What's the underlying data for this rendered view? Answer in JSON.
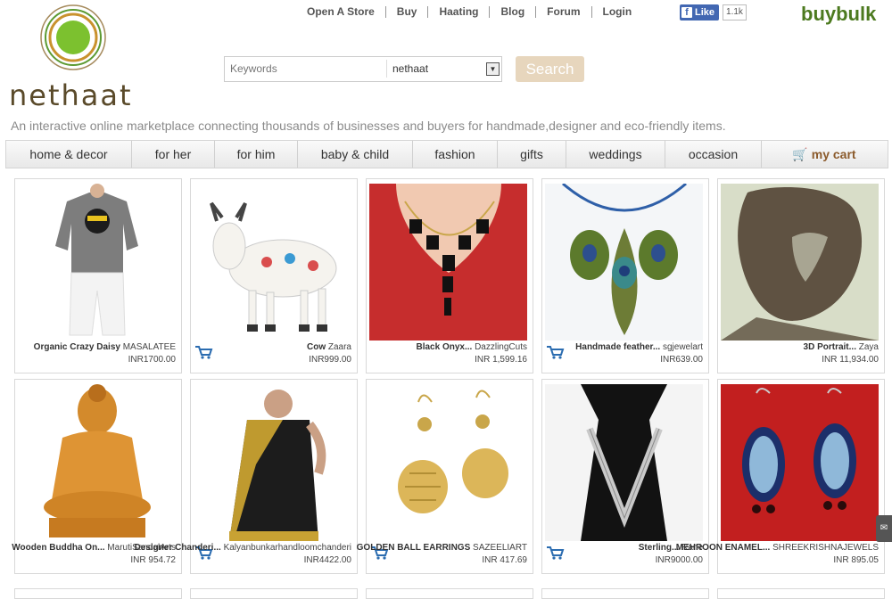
{
  "brand": {
    "logo_text": "nethaat",
    "buybulk": "buybulk",
    "tagline": "An interactive online marketplace connecting thousands of businesses and buyers for handmade,designer and eco-friendly items."
  },
  "topnav": [
    "Open A Store",
    "Buy",
    "Haating",
    "Blog",
    "Forum",
    "Login"
  ],
  "facebook": {
    "like": "Like",
    "count": "1.1k"
  },
  "search": {
    "placeholder": "Keywords",
    "scope": "nethaat",
    "button": "Search"
  },
  "categories": [
    "home & decor",
    "for her",
    "for him",
    "baby & child",
    "fashion",
    "gifts",
    "weddings",
    "occasion"
  ],
  "cart_label": "my cart",
  "colors": {
    "accent": "#8b5a2b",
    "search_button": "#e7d6bd",
    "brand_green": "#4c7a1f"
  },
  "products": [
    {
      "title": "Organic Crazy Daisy",
      "seller": "MASALATEE",
      "price": "INR1700.00",
      "img": "tshirt"
    },
    {
      "title": "Cow",
      "seller": "Zaara",
      "price": "INR999.00",
      "img": "cow"
    },
    {
      "title": "Black Onyx...",
      "seller": "DazzlingCuts",
      "price": "INR 1,599.16",
      "img": "necklace"
    },
    {
      "title": "Handmade feather...",
      "seller": "sgjewelart",
      "price": "INR639.00",
      "img": "feather"
    },
    {
      "title": "3D Portrait...",
      "seller": "Zaya",
      "price": "INR 11,934.00",
      "img": "portrait"
    },
    {
      "title": "Wooden Buddha On...",
      "seller": "MarutiSandalArts",
      "price": "INR 954.72",
      "img": "buddha"
    },
    {
      "title": "Designer Chanderi...",
      "seller": "Kalyanbunkarhandloomchanderi",
      "price": "INR4422.00",
      "img": "saree"
    },
    {
      "title": "GOLDEN BALL EARRINGS",
      "seller": "SAZEELIART",
      "price": "INR 417.69",
      "img": "golden"
    },
    {
      "title": "Sterling...",
      "seller": "Rane",
      "price": "INR9000.00",
      "img": "silver"
    },
    {
      "title": "MEHROON ENAMEL...",
      "seller": "SHREEKRISHNAJEWELS",
      "price": "INR 895.05",
      "img": "enamel"
    }
  ]
}
